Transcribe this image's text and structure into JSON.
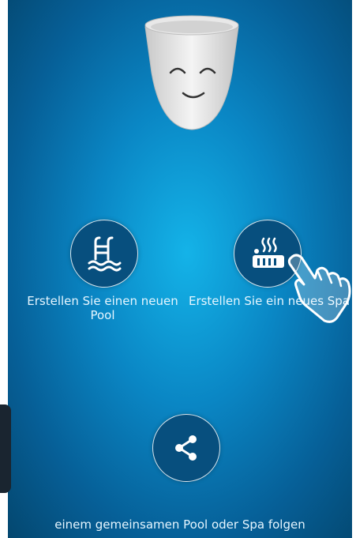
{
  "options": {
    "pool": {
      "label": "Erstellen Sie einen neuen Pool",
      "icon": "pool-ladder-icon"
    },
    "spa": {
      "label": "Erstellen Sie ein neues Spa",
      "icon": "hot-tub-icon"
    }
  },
  "share": {
    "icon": "share-icon"
  },
  "footer": {
    "follow_label": "einem gemeinsamen Pool oder Spa folgen"
  },
  "colors": {
    "background": "#0a86c4",
    "button": "#074f7e",
    "text": "#e6f6ff"
  }
}
